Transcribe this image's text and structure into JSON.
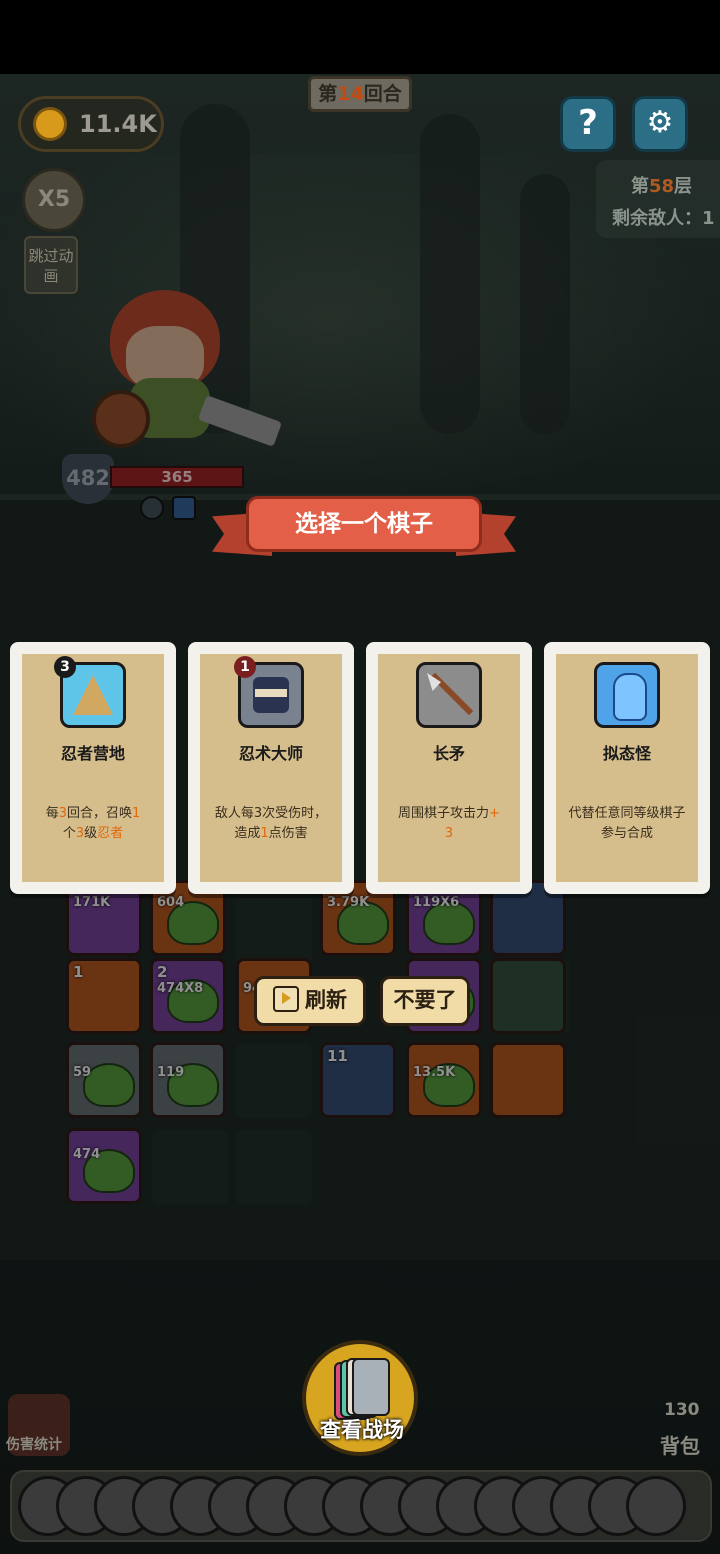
{
  "status": {
    "gold": "11.4K",
    "round_prefix": "第",
    "round_number": "14",
    "round_suffix": "回合",
    "speed": "X5",
    "skip_animation": "跳过动画",
    "floor_prefix": "第",
    "floor_number": "58",
    "floor_suffix": "层",
    "enemies_remaining": "剩余敌人：1"
  },
  "hero": {
    "armor": "482",
    "hp": "365"
  },
  "dialog": {
    "title": "选择一个棋子",
    "cards": [
      {
        "level": "3",
        "name": "忍者营地",
        "desc_parts": [
          "每",
          "3",
          "回合，召唤",
          "1",
          "个",
          "3",
          "级",
          "忍者"
        ],
        "icon": "tent-icon",
        "icon_color": "#5ec4e8"
      },
      {
        "level": "1",
        "name": "忍术大师",
        "desc_parts": [
          "敌人每3次受伤时，造成",
          "1",
          "点伤害"
        ],
        "icon": "ninja-icon",
        "icon_color": "#7a8290"
      },
      {
        "level": "",
        "name": "长矛",
        "desc_parts": [
          "周围棋子攻击力",
          "+",
          "3"
        ],
        "icon": "spear-icon",
        "icon_color": "#8c8c8c"
      },
      {
        "level": "",
        "name": "拟态怪",
        "desc_parts": [
          "代替任意同等级棋子参与合成"
        ],
        "icon": "mimic-icon",
        "icon_color": "#4fa3e8"
      }
    ],
    "refresh_label": "刷新",
    "decline_label": "不要了"
  },
  "board": {
    "piece_labels": [
      "171K",
      "604",
      "X8",
      "3.79K",
      "119X6",
      "474X8",
      "94",
      "59",
      "119",
      "11",
      "13.5K",
      "474",
      "1",
      "2",
      "11"
    ]
  },
  "bottom": {
    "view_battlefield": "查看战场",
    "damage_stats": "伤害统计",
    "bag_count": "130",
    "bag_label": "背包"
  },
  "colors": {
    "banner": "#e45f47",
    "card_bg": "#d5bd8c",
    "highlight": "#e2680b",
    "button_bg": "#f1dca8"
  }
}
